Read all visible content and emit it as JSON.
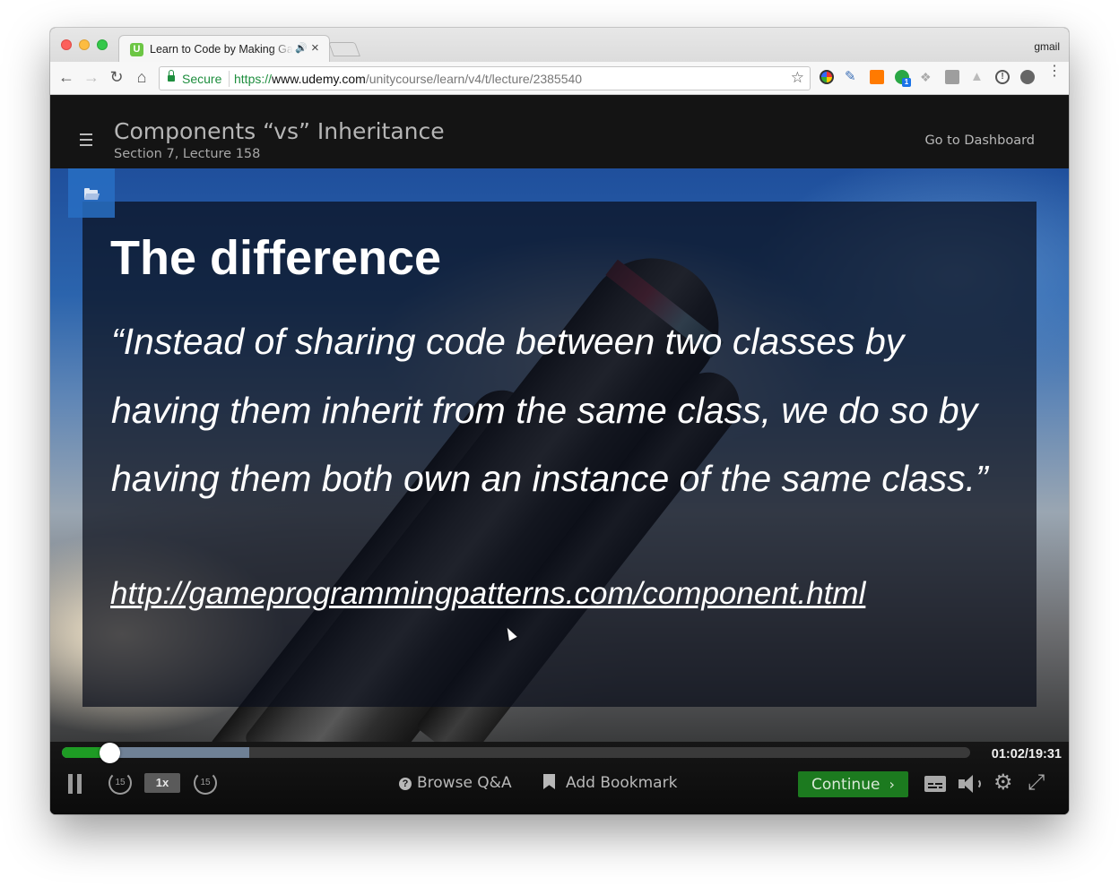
{
  "browser": {
    "tab_title": "Learn to Code by Making Games",
    "favicon_letter": "U",
    "profile_name": "gmail",
    "secure_label": "Secure",
    "url_scheme": "https://",
    "url_host": "www.udemy.com",
    "url_path": "/unitycourse/learn/v4/t/lecture/2385540",
    "extension_badge": "1"
  },
  "lecture": {
    "title": "Components “vs” Inheritance",
    "subtitle": "Section 7, Lecture 158",
    "dashboard_label": "Go to Dashboard"
  },
  "slide": {
    "heading": "The difference",
    "quote": "“Instead of sharing code between two classes by having them inherit from the same class, we do so by having them both own an instance of the same class.”",
    "link": "http://gameprogrammingpatterns.com/component.html"
  },
  "player": {
    "progress_played": 0.052,
    "progress_buffered": 0.206,
    "time": "01:02/19:31",
    "skip_back_label": "15",
    "skip_forward_label": "15",
    "speed_label": "1x",
    "qa_label": "Browse Q&A",
    "bookmark_label": "Add Bookmark",
    "continue_label": "Continue",
    "accent_color": "#1e9c24"
  }
}
